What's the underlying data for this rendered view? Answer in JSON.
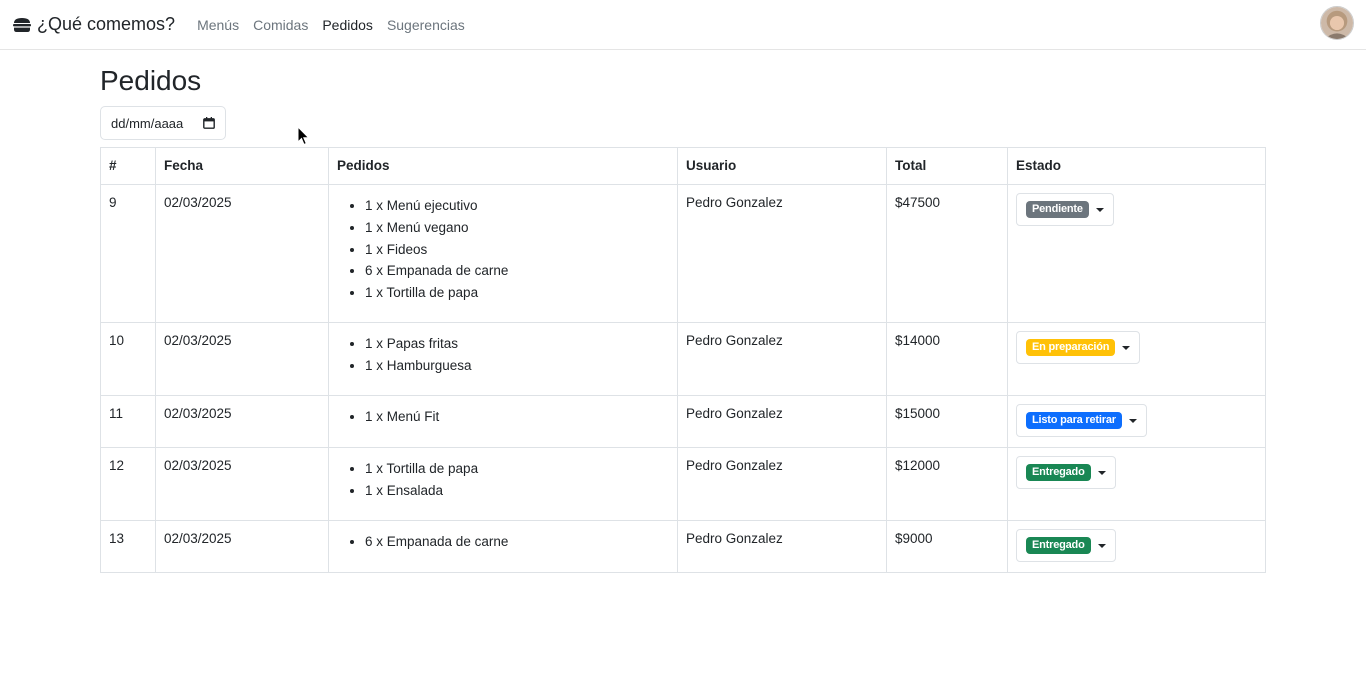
{
  "nav": {
    "brand": "¿Qué comemos?",
    "links": [
      {
        "label": "Menús",
        "active": false
      },
      {
        "label": "Comidas",
        "active": false
      },
      {
        "label": "Pedidos",
        "active": true
      },
      {
        "label": "Sugerencias",
        "active": false
      }
    ],
    "brand_icon": "burger-icon",
    "avatar_icon": "user-avatar"
  },
  "page": {
    "title": "Pedidos",
    "date_placeholder": "dd/mm/aaaa"
  },
  "table": {
    "headers": [
      "#",
      "Fecha",
      "Pedidos",
      "Usuario",
      "Total",
      "Estado"
    ],
    "rows": [
      {
        "id": "9",
        "fecha": "02/03/2025",
        "items": [
          "1 x Menú ejecutivo",
          "1 x Menú vegano",
          "1 x Fideos",
          "6 x Empanada de carne",
          "1 x Tortilla de papa"
        ],
        "usuario": "Pedro Gonzalez",
        "total": "$47500",
        "estado": "Pendiente",
        "estado_color": "#6c757d"
      },
      {
        "id": "10",
        "fecha": "02/03/2025",
        "items": [
          "1 x Papas fritas",
          "1 x Hamburguesa"
        ],
        "usuario": "Pedro Gonzalez",
        "total": "$14000",
        "estado": "En preparación",
        "estado_color": "#ffc107"
      },
      {
        "id": "11",
        "fecha": "02/03/2025",
        "items": [
          "1 x Menú Fit"
        ],
        "usuario": "Pedro Gonzalez",
        "total": "$15000",
        "estado": "Listo para retirar",
        "estado_color": "#0d6efd"
      },
      {
        "id": "12",
        "fecha": "02/03/2025",
        "items": [
          "1 x Tortilla de papa",
          "1 x Ensalada"
        ],
        "usuario": "Pedro Gonzalez",
        "total": "$12000",
        "estado": "Entregado",
        "estado_color": "#198754"
      },
      {
        "id": "13",
        "fecha": "02/03/2025",
        "items": [
          "6 x Empanada de carne"
        ],
        "usuario": "Pedro Gonzalez",
        "total": "$9000",
        "estado": "Entregado",
        "estado_color": "#198754"
      }
    ]
  }
}
